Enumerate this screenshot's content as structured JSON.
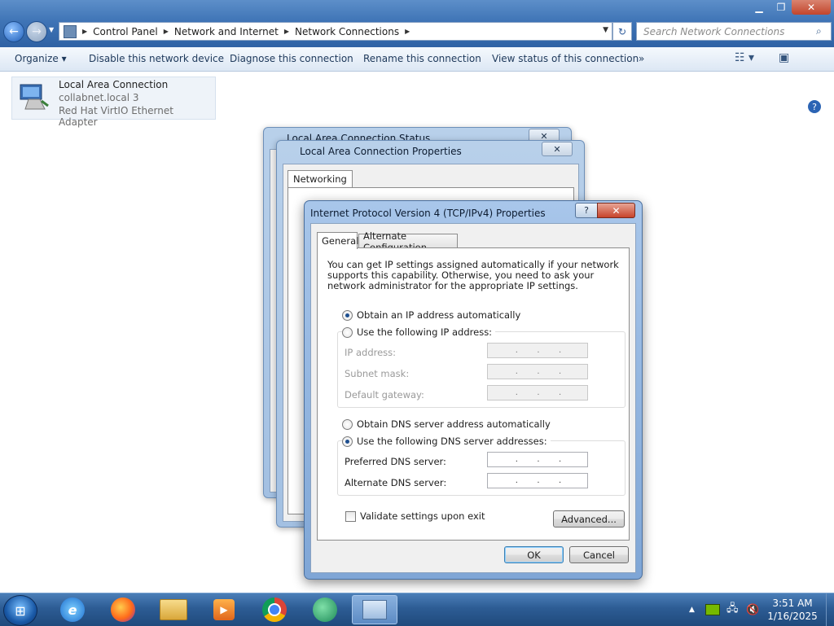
{
  "explorer": {
    "breadcrumb": [
      "Control Panel",
      "Network and Internet",
      "Network Connections"
    ],
    "search_placeholder": "Search Network Connections",
    "toolbar": {
      "organize": "Organize",
      "disable": "Disable this network device",
      "diagnose": "Diagnose this connection",
      "rename": "Rename this connection",
      "view_status": "View status of this connection",
      "more": "»"
    },
    "connection": {
      "name": "Local Area Connection",
      "network": "collabnet.local  3",
      "device": "Red Hat VirtIO Ethernet Adapter"
    }
  },
  "status_dialog": {
    "title": "Local Area Connection Status"
  },
  "properties_dialog": {
    "title": "Local Area Connection Properties",
    "tab": "Networking"
  },
  "ipv4_dialog": {
    "title": "Internet Protocol Version 4 (TCP/IPv4) Properties",
    "tabs": [
      "General",
      "Alternate Configuration"
    ],
    "intro": "You can get IP settings assigned automatically if your network supports this capability. Otherwise, you need to ask your network administrator for the appropriate IP settings.",
    "obtain_ip_auto": "Obtain an IP address automatically",
    "use_following_ip": "Use the following IP address:",
    "ip_address_label": "IP address:",
    "subnet_mask_label": "Subnet mask:",
    "default_gateway_label": "Default gateway:",
    "obtain_dns_auto": "Obtain DNS server address automatically",
    "use_following_dns": "Use the following DNS server addresses:",
    "preferred_dns_label": "Preferred DNS server:",
    "alternate_dns_label": "Alternate DNS server:",
    "validate_label": "Validate settings upon exit",
    "advanced_button": "Advanced...",
    "ok_button": "OK",
    "cancel_button": "Cancel",
    "ip_mode": "automatic",
    "dns_mode": "manual",
    "validate_checked": false
  },
  "taskbar": {
    "apps": [
      "internet-explorer",
      "firefox",
      "file-explorer",
      "media-player",
      "chrome",
      "messenger",
      "network-connections"
    ],
    "time": "3:51 AM",
    "date": "1/16/2025"
  }
}
